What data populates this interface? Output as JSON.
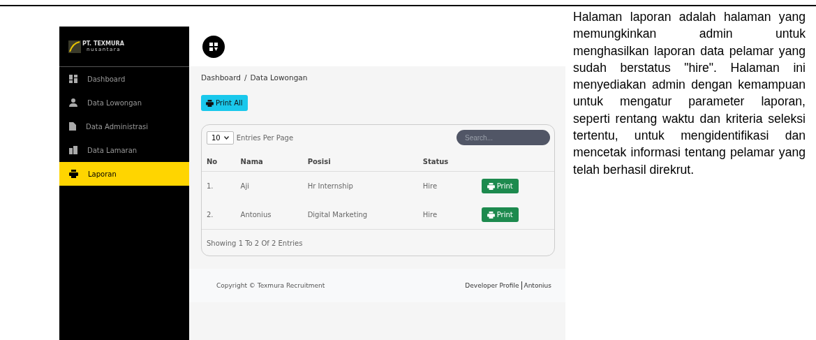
{
  "sidebar": {
    "logo": {
      "title": "PT. TEXMURA",
      "subtitle": "nusantara"
    },
    "items": [
      {
        "label": "Dashboard",
        "selected": false
      },
      {
        "label": "Data Lowongan",
        "selected": false
      },
      {
        "label": "Data Administrasi",
        "selected": false
      },
      {
        "label": "Data Lamaran",
        "selected": false
      },
      {
        "label": "Laporan",
        "selected": true
      }
    ]
  },
  "breadcrumb": {
    "items": [
      "Dashboard",
      "Data Lowongan"
    ],
    "separator": "/"
  },
  "print_all_button": "Print All",
  "table": {
    "entries_select": "10",
    "entries_label": "Entries Per Page",
    "search": {
      "placeholder": "Search..."
    },
    "columns": [
      "No",
      "Nama",
      "Posisi",
      "Status"
    ],
    "rows": [
      {
        "no": "1.",
        "nama": "Aji",
        "posisi": "Hr Internship",
        "status": "Hire",
        "action": "Print"
      },
      {
        "no": "2.",
        "nama": "Antonius",
        "posisi": "Digital Marketing",
        "status": "Hire",
        "action": "Print"
      }
    ],
    "summary": "Showing 1 To 2 Of 2 Entries"
  },
  "footer": {
    "copyright": "Copyright © Texmura Recruitment",
    "links": [
      "Developer Profile",
      "Antonius"
    ]
  },
  "description": "Halaman laporan adalah halaman yang memungkinkan admin untuk menghasilkan laporan data pelamar yang sudah berstatus \"hire\". Halaman ini menyediakan admin dengan kemampuan untuk mengatur parameter laporan, seperti rentang waktu dan kriteria seleksi tertentu, untuk mengidentifikasi dan mencetak informasi tentang pelamar yang telah berhasil direkrut."
}
